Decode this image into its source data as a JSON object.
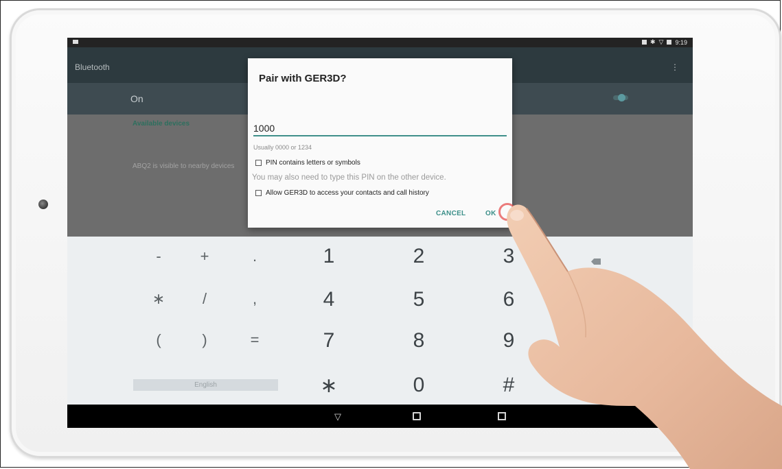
{
  "status_bar": {
    "time": "9:19"
  },
  "app_bar": {
    "title": "Bluetooth"
  },
  "bluetooth_toggle": {
    "label": "On",
    "enabled": true
  },
  "content": {
    "section_header": "Available devices",
    "visibility_text": "ABQ2 is visible to nearby devices"
  },
  "dialog": {
    "title": "Pair with GER3D?",
    "pin_value": "1000",
    "pin_hint": "Usually 0000 or 1234",
    "checkbox_pin_letters": "PIN contains letters or symbols",
    "also_type_text": "You may also need to type this PIN on the other device.",
    "checkbox_contacts": "Allow GER3D to access your contacts and call history",
    "cancel_label": "CANCEL",
    "ok_label": "OK"
  },
  "keyboard": {
    "row1": [
      "-",
      "+",
      ".",
      "1",
      "2",
      "3"
    ],
    "row2": [
      "∗",
      "/",
      ",",
      "4",
      "5",
      "6"
    ],
    "row3": [
      "(",
      ")",
      "=",
      "7",
      "8",
      "9"
    ],
    "row4": [
      "∗",
      "0",
      "#"
    ],
    "space_label": "English"
  },
  "icons": {
    "backspace": "backspace-icon",
    "nav_back": "nav-back-icon",
    "nav_home": "nav-home-icon",
    "nav_recent": "nav-recent-icon"
  },
  "colors": {
    "accent": "#3f8f8a",
    "app_bar": "#2d3a3f",
    "keyboard_bg": "#eceff1"
  }
}
